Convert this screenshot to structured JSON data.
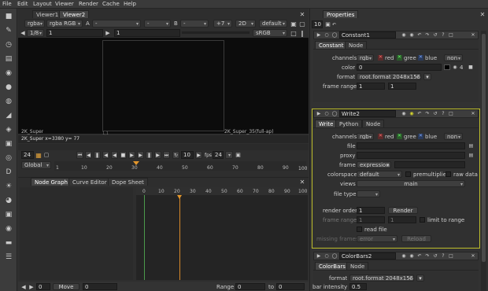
{
  "menu": [
    "File",
    "Edit",
    "Layout",
    "Viewer",
    "Render",
    "Cache",
    "Help"
  ],
  "viewer": {
    "tabs": [
      "Viewer1",
      "Viewer2"
    ],
    "row1": {
      "channels": "rgba",
      "layer": "rgba RGB",
      "a_label": "A",
      "a_value": "-",
      "b_label": "B",
      "b_value": "-",
      "gain": "+7",
      "mode": "2D",
      "lut": "default"
    },
    "row2": {
      "frame_ratio": "1/8",
      "frame_num": "1",
      "zoom": "1",
      "colorspace": "sRGB"
    },
    "format_label_left": "2K_Super",
    "format_label_right": "2K_Super_35(full-ap)",
    "corner_tl": "1,1",
    "coord_readout": "2K_Super  x=3380 y=  77",
    "timeline": {
      "frame": "24",
      "fps_label": "fps",
      "fps_value": "24",
      "step": "10",
      "global": "Global",
      "ticks": [
        "1",
        "10",
        "20",
        "30",
        "40",
        "50",
        "60",
        "70",
        "80",
        "90",
        "100"
      ],
      "end": "100"
    }
  },
  "lower": {
    "tabs": [
      "Node Graph",
      "Curve Editor",
      "Dope Sheet"
    ],
    "ticks": [
      "0",
      "10",
      "20",
      "30",
      "40",
      "50",
      "60",
      "70",
      "80",
      "90",
      "100"
    ],
    "bottom": {
      "move_label": "Move",
      "move_value": "0",
      "range_label": "Range",
      "range_start": "0",
      "to_label": "to",
      "range_end": "0",
      "left_value": "0"
    }
  },
  "properties": {
    "title": "Properties",
    "count": "10",
    "constant": {
      "name": "Constant1",
      "tabs": [
        "Constant",
        "Node"
      ],
      "channels_label": "channels",
      "channels": "rgb",
      "ch_r": "red",
      "ch_g": "gree",
      "ch_b": "blue",
      "none": "non",
      "color_label": "color",
      "color_value": "0",
      "color_right": "4",
      "format_label": "format",
      "format_value": "root.format 2048x1556",
      "frame_range_label": "frame range",
      "fr_start": "1",
      "fr_end": "1"
    },
    "write": {
      "name": "Write2",
      "tabs": [
        "Write",
        "Python",
        "Node"
      ],
      "channels_label": "channels",
      "channels": "rgb",
      "ch_r": "red",
      "ch_g": "gree",
      "ch_b": "blue",
      "none": "non",
      "file_label": "file",
      "proxy_label": "proxy",
      "frame_label": "frame",
      "frame_mode": "expression",
      "colorspace_label": "colorspace",
      "colorspace": "default",
      "premult": "premultiplied",
      "raw": "raw data",
      "views_label": "views",
      "views": "main",
      "filetype_label": "file type",
      "render_order_label": "render order",
      "render_order": "1",
      "render_btn": "Render",
      "frame_range_label": "frame range",
      "fr_start": "1",
      "fr_end": "1",
      "limit": "limit to range",
      "read_file": "read file",
      "missing_label": "missing frames",
      "missing": "error",
      "reload": "Reload"
    },
    "colorbars": {
      "name": "ColorBars2",
      "tabs": [
        "ColorBars",
        "Node"
      ],
      "format_label": "format",
      "format_value": "root.format 2048x1556",
      "bar_label": "bar intensity",
      "bar_value": "0.5"
    }
  }
}
